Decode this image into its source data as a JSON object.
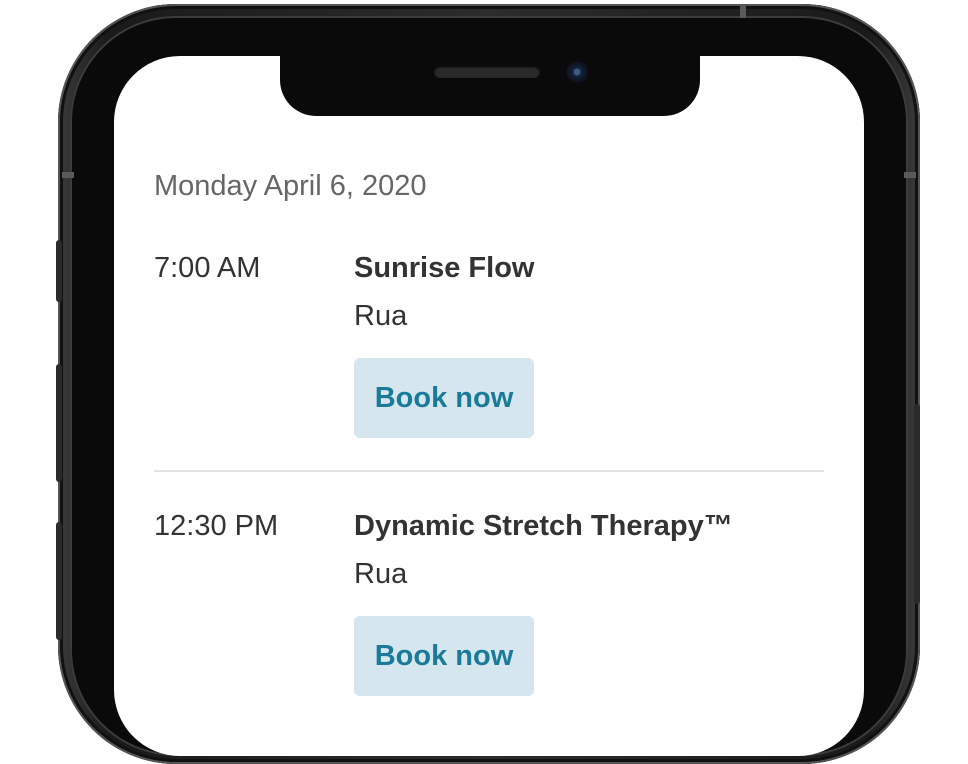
{
  "schedule": {
    "date": "Monday April 6, 2020",
    "sessions": [
      {
        "time": "7:00 AM",
        "class_name": "Sunrise Flow",
        "location": "Rua",
        "button_label": "Book now"
      },
      {
        "time": "12:30 PM",
        "class_name": "Dynamic Stretch Therapy™",
        "location": "Rua",
        "button_label": "Book now"
      }
    ]
  },
  "colors": {
    "button_bg": "#d6e6ee",
    "button_text": "#1a7a9a",
    "text": "#333333",
    "muted_text": "#666666"
  }
}
